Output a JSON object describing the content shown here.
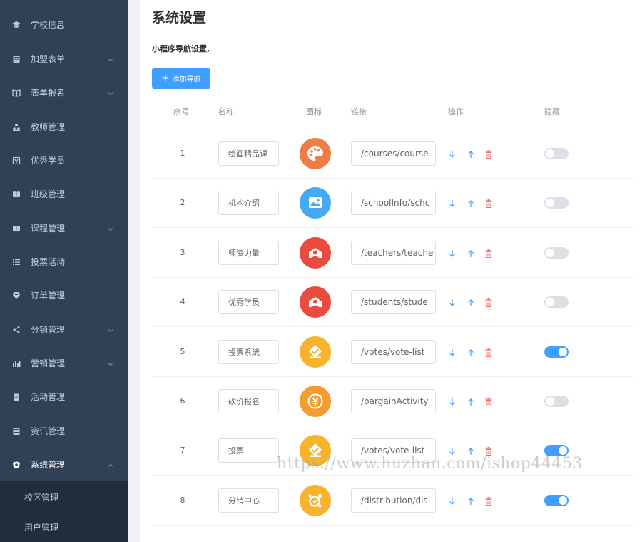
{
  "sidebar": {
    "items": [
      {
        "label": "学校信息",
        "icon": "graduation-cap-icon",
        "has_submenu": false
      },
      {
        "label": "加盟表单",
        "icon": "form-icon",
        "has_submenu": true
      },
      {
        "label": "表单报名",
        "icon": "book-open-icon",
        "has_submenu": true
      },
      {
        "label": "教师管理",
        "icon": "users-icon",
        "has_submenu": false
      },
      {
        "label": "优秀学员",
        "icon": "award-icon",
        "has_submenu": false
      },
      {
        "label": "班级管理",
        "icon": "book-icon",
        "has_submenu": false
      },
      {
        "label": "课程管理",
        "icon": "book-icon",
        "has_submenu": true
      },
      {
        "label": "投票活动",
        "icon": "list-icon",
        "has_submenu": false
      },
      {
        "label": "订单管理",
        "icon": "order-icon",
        "has_submenu": false
      },
      {
        "label": "分销管理",
        "icon": "share-icon",
        "has_submenu": true
      },
      {
        "label": "营销管理",
        "icon": "bar-chart-icon",
        "has_submenu": true
      },
      {
        "label": "活动管理",
        "icon": "calendar-icon",
        "has_submenu": false
      },
      {
        "label": "资讯管理",
        "icon": "news-icon",
        "has_submenu": false
      },
      {
        "label": "系统管理",
        "icon": "gear-icon",
        "has_submenu": true,
        "expanded": true
      }
    ],
    "subitems": [
      {
        "label": "校区管理"
      },
      {
        "label": "用户管理"
      }
    ]
  },
  "main": {
    "title": "系统设置",
    "section_title": "小程序导航设置,",
    "add_button": {
      "icon": "+",
      "label": "添加导航"
    },
    "columns": [
      "序号",
      "名称",
      "图标",
      "链接",
      "操作",
      "隐藏"
    ],
    "rows": [
      {
        "index": "1",
        "name": "绘画精品课",
        "icon": "palette-icon",
        "icon_color": "#ef7b45",
        "link": "/courses/course",
        "hidden": false
      },
      {
        "index": "2",
        "name": "机构介绍",
        "icon": "picture-icon",
        "icon_color": "#46a9f3",
        "link": "/schoolInfo/schc",
        "hidden": false
      },
      {
        "index": "3",
        "name": "师资力量",
        "icon": "teacher-icon",
        "icon_color": "#ea4b3f",
        "link": "/teachers/teache",
        "hidden": false
      },
      {
        "index": "4",
        "name": "优秀学员",
        "icon": "teacher-icon",
        "icon_color": "#ea4b3f",
        "link": "/students/stude",
        "hidden": false
      },
      {
        "index": "5",
        "name": "投票系统",
        "icon": "vote-icon",
        "icon_color": "#f7b32b",
        "link": "/votes/vote-list",
        "hidden": true
      },
      {
        "index": "6",
        "name": "砍价报名",
        "icon": "bargain-icon",
        "icon_color": "#f59c2c",
        "link": "/bargainActivity",
        "hidden": false
      },
      {
        "index": "7",
        "name": "投票",
        "icon": "vote-icon",
        "icon_color": "#f7b32b",
        "link": "/votes/vote-list",
        "hidden": true
      },
      {
        "index": "8",
        "name": "分销中心",
        "icon": "distribution-icon",
        "icon_color": "#f7b32b",
        "link": "/distribution/dis",
        "hidden": true
      }
    ]
  },
  "watermark": "https://www.huzhan.com/ishop44453",
  "colors": {
    "sidebar_bg": "#304156",
    "sidebar_sub_bg": "#1f2d3d",
    "accent": "#409eff",
    "danger": "#f56c6c"
  }
}
